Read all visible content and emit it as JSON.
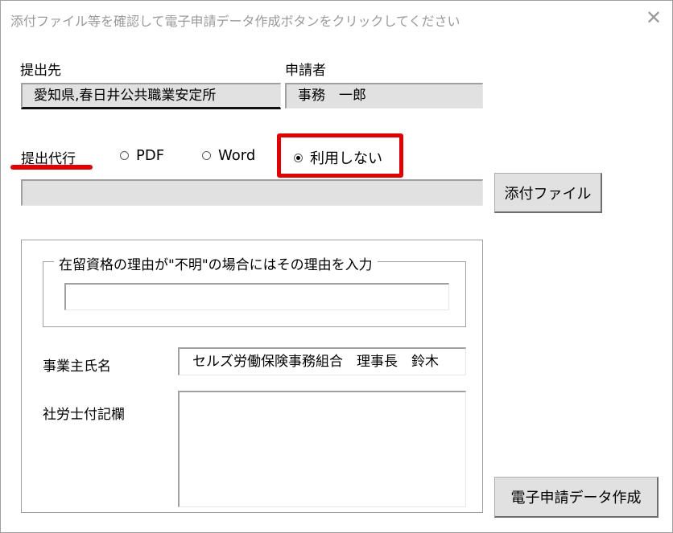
{
  "window": {
    "title": "添付ファイル等を確認して電子申請データ作成ボタンをクリックしてください",
    "close_glyph": "✕"
  },
  "destination": {
    "label": "提出先",
    "value": "愛知県,春日井公共職業安定所"
  },
  "applicant": {
    "label": "申請者",
    "value": "事務　一郎"
  },
  "proxy": {
    "label": "提出代行",
    "options": [
      {
        "label": "PDF",
        "checked": false
      },
      {
        "label": "Word",
        "checked": false
      },
      {
        "label": "利用しない",
        "checked": true
      }
    ]
  },
  "attachment": {
    "path_value": "",
    "button_label": "添付ファイル"
  },
  "residence": {
    "legend": "在留資格の理由が\"不明\"の場合にはその理由を入力",
    "value": ""
  },
  "employer": {
    "label": "事業主氏名",
    "value": "セルズ労働保険事務組合　理事長　鈴木"
  },
  "remarks": {
    "label": "社労士付記欄",
    "value": ""
  },
  "submit": {
    "label": "電子申請データ作成"
  },
  "colors": {
    "highlight": "#e00000",
    "field_bg": "#e1e1e1",
    "title_text": "#9a9a9a"
  }
}
